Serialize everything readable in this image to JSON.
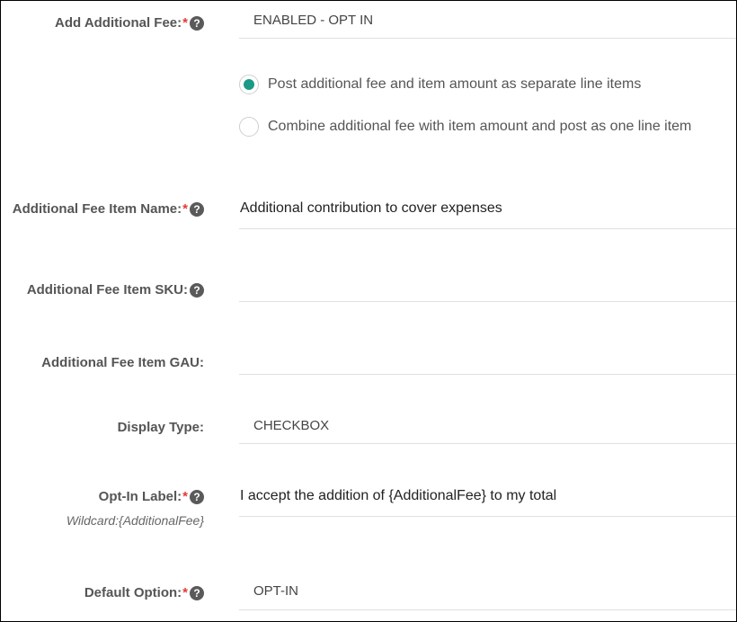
{
  "fields": {
    "add_fee": {
      "label": "Add Additional Fee:",
      "required": "*",
      "help": "?",
      "value": "ENABLED - OPT IN"
    },
    "post_options": [
      {
        "label": "Post additional fee and item amount as separate line items",
        "selected": true
      },
      {
        "label": "Combine additional fee with item amount and post as one line item",
        "selected": false
      }
    ],
    "item_name": {
      "label": "Additional Fee Item Name:",
      "required": "*",
      "help": "?",
      "value": "Additional contribution to cover expenses"
    },
    "item_sku": {
      "label": "Additional Fee Item SKU:",
      "help": "?",
      "value": ""
    },
    "item_gau": {
      "label": "Additional Fee Item GAU:",
      "value": ""
    },
    "display_type": {
      "label": "Display Type:",
      "value": "CHECKBOX"
    },
    "opt_in_label": {
      "label": "Opt-In Label:",
      "required": "*",
      "help": "?",
      "wildcard": "Wildcard:{AdditionalFee}",
      "value": "I accept the addition of {AdditionalFee} to my total"
    },
    "default_option": {
      "label": "Default Option:",
      "required": "*",
      "help": "?",
      "value": "OPT-IN"
    }
  },
  "colors": {
    "accent": "#1a9a87",
    "required": "#e53935",
    "label": "#555555"
  }
}
